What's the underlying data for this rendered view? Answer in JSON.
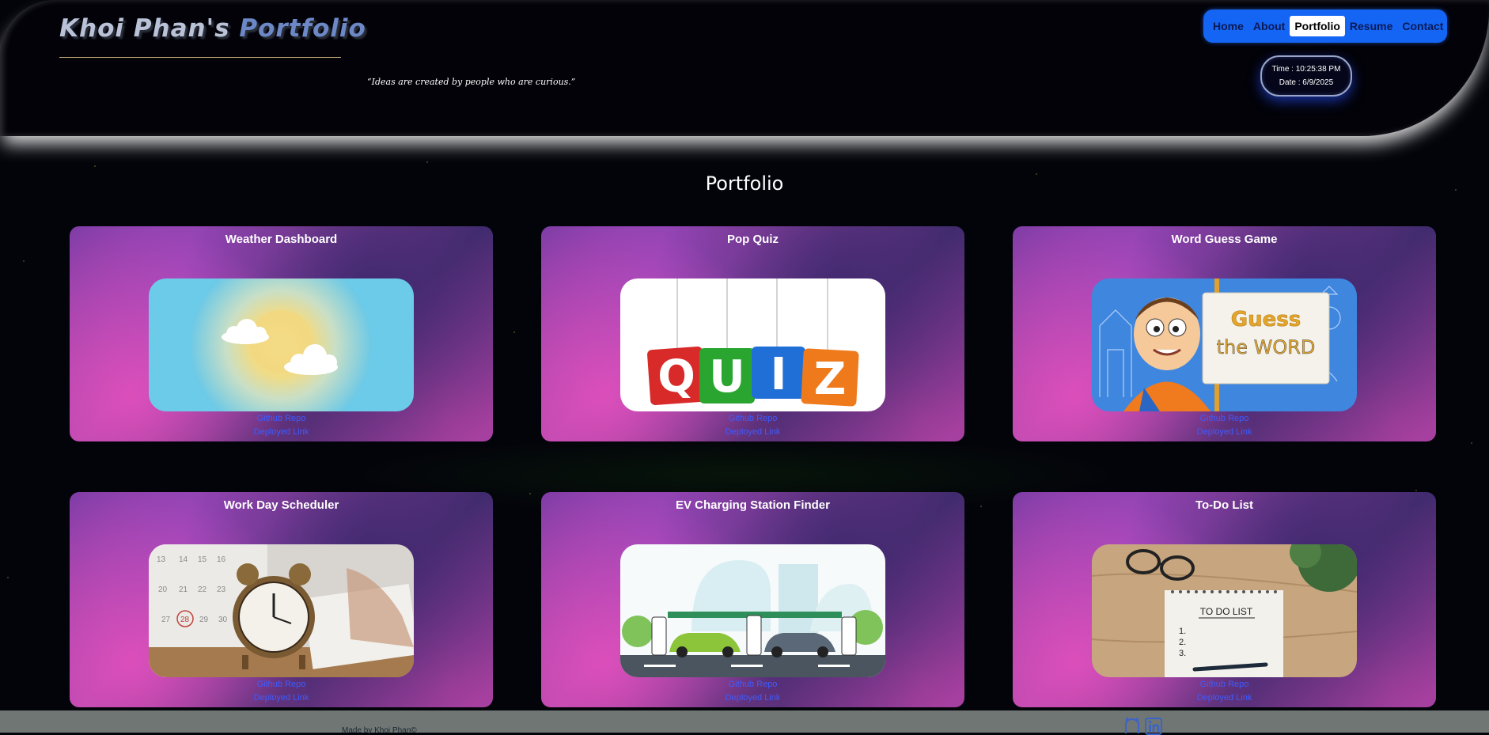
{
  "header": {
    "title_main": "Khoi Phan's",
    "title_accent": "Portfolio",
    "quote": "“Ideas are created by people who are curious.”",
    "nav": [
      {
        "label": "Home"
      },
      {
        "label": "About"
      },
      {
        "label": "Portfolio",
        "active": true
      },
      {
        "label": "Resume"
      },
      {
        "label": "Contact"
      }
    ],
    "clock": {
      "time": "Time : 10:25:38 PM",
      "date": "Date : 6/9/2025"
    }
  },
  "portfolio": {
    "heading": "Portfolio",
    "projects": [
      {
        "title": "Weather Dashboard",
        "image": "weather-sun-cloud-image",
        "repo_label": "Github Repo",
        "deploy_label": "Deployed Link"
      },
      {
        "title": "Pop Quiz",
        "image": "quiz-letter-tiles-image",
        "repo_label": "Github Repo",
        "deploy_label": "Deployed Link"
      },
      {
        "title": "Word Guess Game",
        "image": "guess-the-word-cartoon-image",
        "repo_label": "Github Repo",
        "deploy_label": "Deployed Link"
      },
      {
        "title": "Work Day Scheduler",
        "image": "alarm-clock-calendar-image",
        "repo_label": "Github Repo",
        "deploy_label": "Deployed Link"
      },
      {
        "title": "EV Charging Station Finder",
        "image": "ev-charging-station-image",
        "repo_label": "Github Repo",
        "deploy_label": "Deployed Link"
      },
      {
        "title": "To-Do List",
        "image": "todo-notepad-image",
        "repo_label": "Github Repo",
        "deploy_label": "Deployed Link"
      }
    ],
    "quiz_letters": [
      "Q",
      "U",
      "I",
      "Z"
    ],
    "word_guess_text": [
      "Guess",
      "the WORD"
    ],
    "calendar_days": [
      "13",
      "14",
      "15",
      "16",
      "20",
      "21",
      "22",
      "23",
      "27",
      "28",
      "29",
      "30"
    ],
    "todo_text": "TO DO LIST",
    "todo_numbers": [
      "1.",
      "2.",
      "3."
    ]
  },
  "footer": {
    "made_by": "Made by Khoi Phan©",
    "icons": [
      "github-icon",
      "linkedin-icon"
    ]
  },
  "colors": {
    "nav_bg": "#1565f5",
    "link": "#3d5cff",
    "title_accent": "#6d88c7",
    "footer_bg": "#6f7674"
  }
}
